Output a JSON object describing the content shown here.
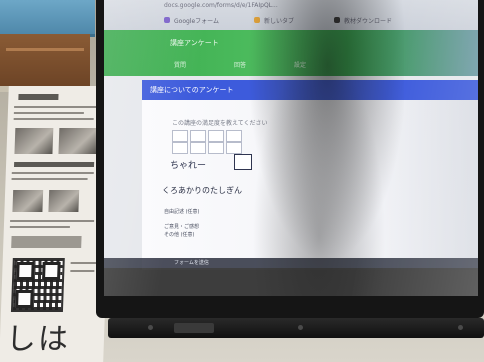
{
  "browser": {
    "url": "docs.google.com/forms/d/e/1FAIpQL...",
    "bookmarks": [
      "Googleフォーム",
      "新しいタブ",
      "教材ダウンロード"
    ]
  },
  "form": {
    "title": "講座アンケート",
    "header_tabs": [
      "質問",
      "回答",
      "設定"
    ],
    "section_title": "講座についてのアンケート",
    "question1_label": "この講座の満足度を教えてください",
    "scale_low_label": "ちゃれー",
    "question2_label": "くろあかりのたしぎん",
    "question2_note": "自由記述 (任意)",
    "question3_line1": "ご意見・ご感想",
    "question3_line2": "その他 (任意)"
  },
  "taskbar": {
    "label": "フォームを送信"
  },
  "flyer": {
    "big_text": "しは"
  },
  "colors": {
    "header_green": "#37a94b",
    "section_blue": "#3d5bdc",
    "bezel": "#151515"
  }
}
